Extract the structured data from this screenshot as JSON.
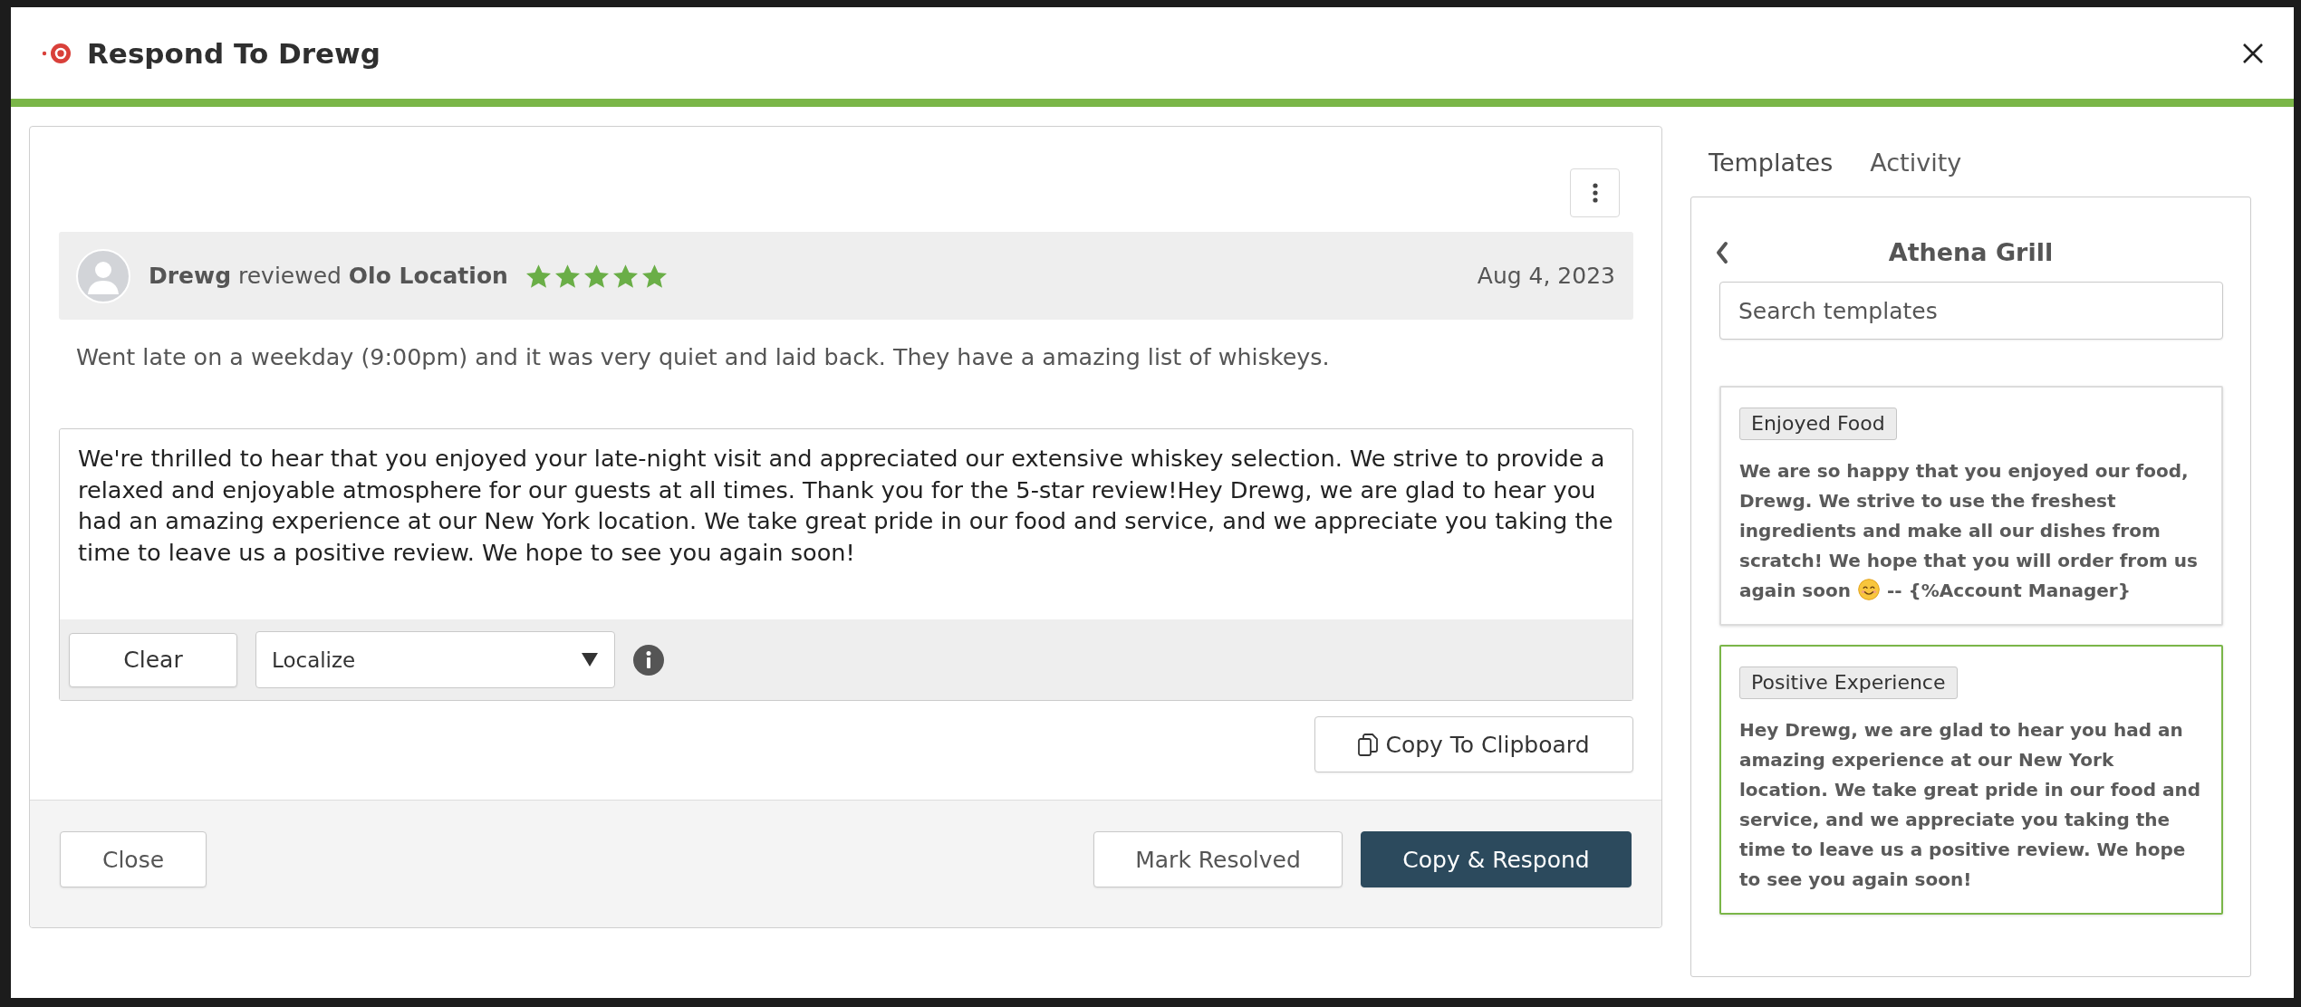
{
  "dialog": {
    "title": "Respond To Drewg"
  },
  "review": {
    "headline": "**Drewg** reviewed **Olo Location**",
    "stars": 5,
    "date": "Aug 4, 2023",
    "text": "Went late on a weekday (9:00pm) and it was very quiet and laid back. They have a amazing list of whiskeys."
  },
  "reply": {
    "value": "We're thrilled to hear that you enjoyed your late-night visit and appreciated our extensive whiskey selection. We strive to provide a relaxed and enjoyable atmosphere for our guests at all times. Thank you for the 5-star review!Hey Drewg, we are glad to hear you had an amazing experience at our New York location. We take great pride in our food and service, and we appreciate you taking the time to leave us a positive review. We hope to see you again soon!",
    "clear_button": "Clear",
    "localize": {
      "value": "Localize"
    },
    "copy_button": "Copy To Clipboard"
  },
  "footer": {
    "close_button": "Close",
    "buttons": [
      {
        "label": "Mark Resolved",
        "kind": "outline"
      },
      {
        "label": "Copy & Respond",
        "kind": "primary"
      }
    ]
  },
  "side_tabs": [
    {
      "label": "Templates",
      "selected": true
    },
    {
      "label": "Activity",
      "selected": false
    }
  ],
  "templates_panel": {
    "title": "Athena Grill",
    "search": {
      "placeholder": "Search templates"
    },
    "templates": [
      {
        "tag": "Enjoyed Food",
        "selected": false,
        "body": [
          {
            "kind": "text",
            "text": "We are so happy that you enjoyed our food, Drewg. We strive to use the freshest ingredients and make all our dishes from scratch! We hope that you will order from us again soon"
          },
          {
            "kind": "emoji"
          },
          {
            "kind": "text",
            "text": "-- {%Account Manager}"
          }
        ]
      },
      {
        "tag": "Positive Experience",
        "selected": true,
        "body": [
          {
            "kind": "text",
            "text": "Hey Drewg, we are glad to hear you had an amazing experience at our New York location. We take great pride in our food and service, and we appreciate you taking the time to leave us a positive review. We hope to see you again soon!"
          }
        ]
      }
    ]
  }
}
